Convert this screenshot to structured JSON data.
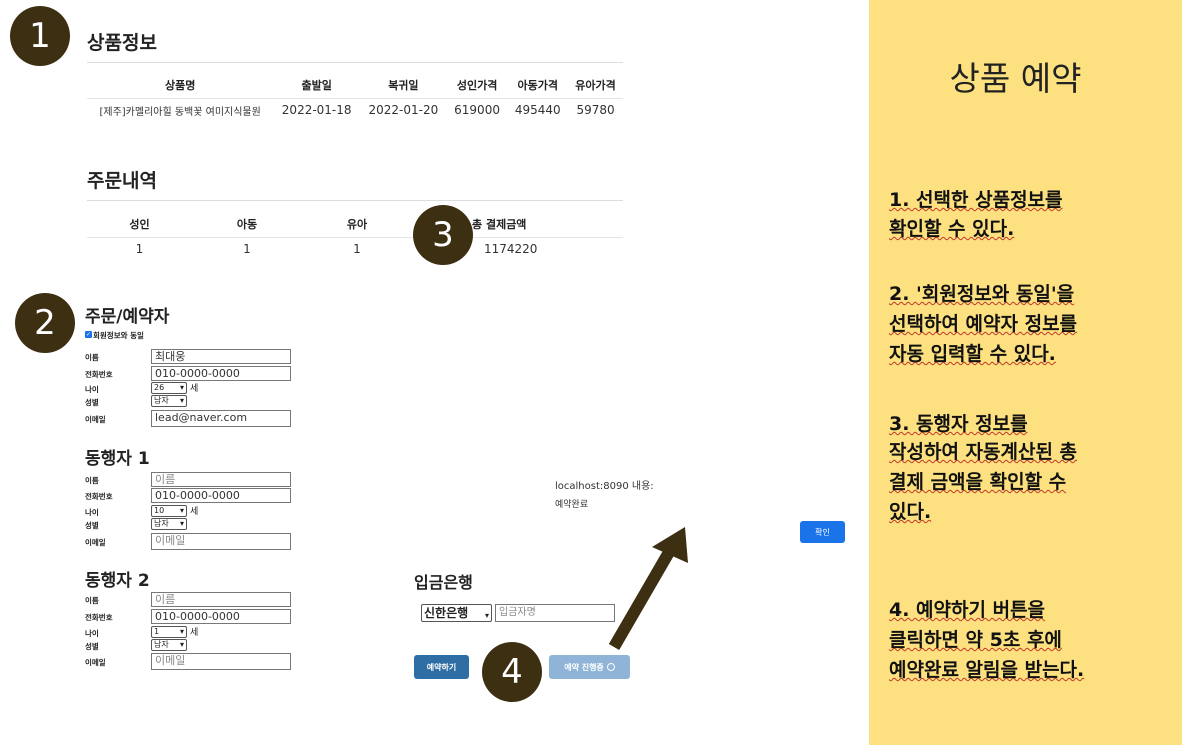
{
  "product_info": {
    "title": "상품정보",
    "headers": [
      "상품명",
      "출발일",
      "복귀일",
      "성인가격",
      "아동가격",
      "유아가격"
    ],
    "row": [
      "[제주]카멜리아힐 동백꽃 여미지식물원",
      "2022-01-18",
      "2022-01-20",
      "619000",
      "495440",
      "59780"
    ]
  },
  "order_details": {
    "title": "주문내역",
    "headers": [
      "성인",
      "아동",
      "유아",
      "총 결제금액"
    ],
    "row": [
      "1",
      "1",
      "1",
      "1174220"
    ]
  },
  "orderer": {
    "title": "주문/예약자",
    "same_as_member_label": "회원정보와 동일",
    "same_as_member_checked": true,
    "name_label": "이름",
    "name_value": "최대웅",
    "phone_label": "전화번호",
    "phone_value": "010-0000-0000",
    "age_label": "나이",
    "age_value": "26",
    "age_unit": "세",
    "gender_label": "성별",
    "gender_value": "남자",
    "email_label": "이메일",
    "email_value": "lead@naver.com"
  },
  "companion1": {
    "title": "동행자 1",
    "name_label": "이름",
    "name_placeholder": "이름",
    "phone_label": "전화번호",
    "phone_value": "010-0000-0000",
    "age_label": "나이",
    "age_value": "10",
    "age_unit": "세",
    "gender_label": "성별",
    "gender_value": "남자",
    "email_label": "이메일",
    "email_placeholder": "이메일"
  },
  "companion2": {
    "title": "동행자 2",
    "name_label": "이름",
    "name_placeholder": "이름",
    "phone_label": "전화번호",
    "phone_value": "010-0000-0000",
    "age_label": "나이",
    "age_value": "1",
    "age_unit": "세",
    "gender_label": "성별",
    "gender_value": "남자",
    "email_label": "이메일",
    "email_placeholder": "이메일"
  },
  "bank": {
    "title": "입금은행",
    "bank_value": "신한은행",
    "depositor_placeholder": "입금자명"
  },
  "buttons": {
    "reserve_label": "예약하기",
    "processing_label": "예약 진행중",
    "ok_label": "확인"
  },
  "alert": {
    "origin": "localhost:8090 내용:",
    "message": "예약완료"
  },
  "badges": [
    "1",
    "2",
    "3",
    "4"
  ],
  "panel": {
    "title": "상품 예약",
    "steps": [
      [
        "1. 선택한 상품정보를",
        "확인할 수 있다."
      ],
      [
        "2. '회원정보와 동일'을",
        "선택하여 예약자 정보를",
        "자동 입력할 수 있다."
      ],
      [
        "3. 동행자 정보를",
        "작성하여 자동계산된 총",
        "결제 금액을 확인할 수",
        "있다."
      ],
      [
        "4. 예약하기 버튼을",
        "클릭하면 약 5초 후에",
        "예약완료 알림을 받는다."
      ]
    ]
  },
  "colors": {
    "badge": "#3d2f12",
    "panel": "#fde07f",
    "reserve_button": "#2f6ea5",
    "processing_button": "#8fb4d8",
    "ok_button": "#1a73e8",
    "arrow": "#3d2f12"
  }
}
